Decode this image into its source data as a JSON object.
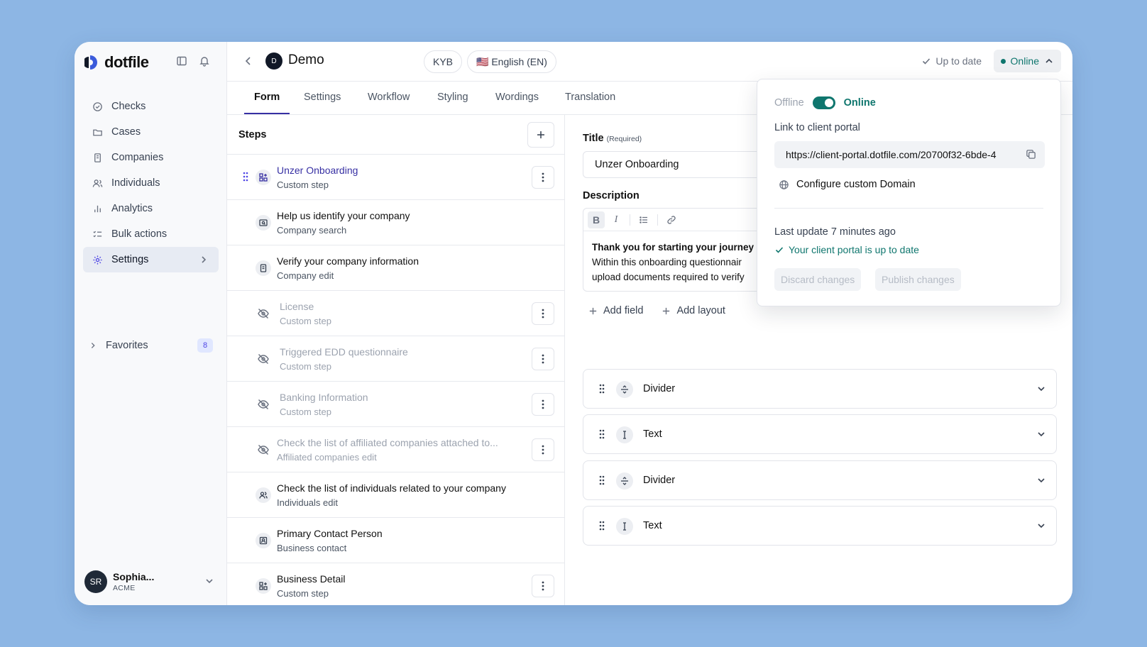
{
  "app": {
    "logo_text": "dotfile",
    "brand_color": "#3730a3",
    "accent_green": "#0f766e"
  },
  "sidebar": {
    "items": [
      {
        "label": "Checks",
        "icon": "check-circle-icon"
      },
      {
        "label": "Cases",
        "icon": "folder-icon"
      },
      {
        "label": "Companies",
        "icon": "building-icon"
      },
      {
        "label": "Individuals",
        "icon": "users-icon"
      },
      {
        "label": "Analytics",
        "icon": "bar-chart-icon"
      },
      {
        "label": "Bulk actions",
        "icon": "checklist-icon"
      },
      {
        "label": "Settings",
        "icon": "gear-icon",
        "active": true
      }
    ],
    "favorites": {
      "label": "Favorites",
      "count": "8"
    },
    "user": {
      "initials": "SR",
      "name": "Sophia...",
      "org": "ACME"
    }
  },
  "header": {
    "workspace_initial": "D",
    "workspace_title": "Demo",
    "chip_type": "KYB",
    "chip_language": "🇺🇸 English (EN)",
    "status_text": "Up to date",
    "online_label": "Online"
  },
  "tabs": [
    {
      "label": "Form",
      "active": true
    },
    {
      "label": "Settings"
    },
    {
      "label": "Workflow"
    },
    {
      "label": "Styling"
    },
    {
      "label": "Wordings"
    },
    {
      "label": "Translation"
    }
  ],
  "steps": {
    "title": "Steps",
    "items": [
      {
        "title": "Unzer Onboarding",
        "subtitle": "Custom step",
        "state": "active",
        "icon": "custom-step-icon",
        "menu": true
      },
      {
        "title": "Help us identify your company",
        "subtitle": "Company search",
        "state": "normal",
        "icon": "company-search-icon",
        "menu": false
      },
      {
        "title": "Verify your company information",
        "subtitle": "Company edit",
        "state": "normal",
        "icon": "building-icon",
        "menu": false
      },
      {
        "title": "License",
        "subtitle": "Custom step",
        "state": "hidden",
        "icon": "eye-off-icon",
        "menu": true
      },
      {
        "title": "Triggered EDD questionnaire",
        "subtitle": "Custom step",
        "state": "hidden",
        "icon": "eye-off-icon",
        "menu": true
      },
      {
        "title": "Banking Information",
        "subtitle": "Custom step",
        "state": "hidden",
        "icon": "eye-off-icon",
        "menu": true
      },
      {
        "title": "Check the list of affiliated companies attached to...",
        "subtitle": "Affiliated companies edit",
        "state": "hidden",
        "icon": "eye-off-icon",
        "menu": true
      },
      {
        "title": "Check the list of individuals related to your company",
        "subtitle": "Individuals edit",
        "state": "normal",
        "icon": "users-icon",
        "menu": false
      },
      {
        "title": "Primary Contact Person",
        "subtitle": "Business contact",
        "state": "normal",
        "icon": "contact-icon",
        "menu": false
      },
      {
        "title": "Business Detail",
        "subtitle": "Custom step",
        "state": "normal",
        "icon": "custom-step-icon",
        "menu": true
      }
    ]
  },
  "editor": {
    "title_label": "Title",
    "title_required": "(Required)",
    "title_value": "Unzer Onboarding",
    "description_label": "Description",
    "description_bold": "Thank you for starting your journey",
    "description_line2": "Within this onboarding questionnair",
    "description_line3": "upload documents required to verify",
    "add_field": "Add field",
    "add_layout": "Add layout",
    "fields": [
      {
        "name": "Divider",
        "icon": "divider-icon"
      },
      {
        "name": "Text",
        "icon": "text-cursor-icon"
      },
      {
        "name": "Divider",
        "icon": "divider-icon"
      },
      {
        "name": "Text",
        "icon": "text-cursor-icon"
      }
    ]
  },
  "popover": {
    "offline_label": "Offline",
    "online_label": "Online",
    "link_label": "Link to client portal",
    "url": "https://client-portal.dotfile.com/20700f32-6bde-4",
    "configure_domain": "Configure custom Domain",
    "last_update": "Last update 7 minutes ago",
    "uptodate_text": "Your client portal is up to date",
    "discard_label": "Discard changes",
    "publish_label": "Publish changes"
  }
}
